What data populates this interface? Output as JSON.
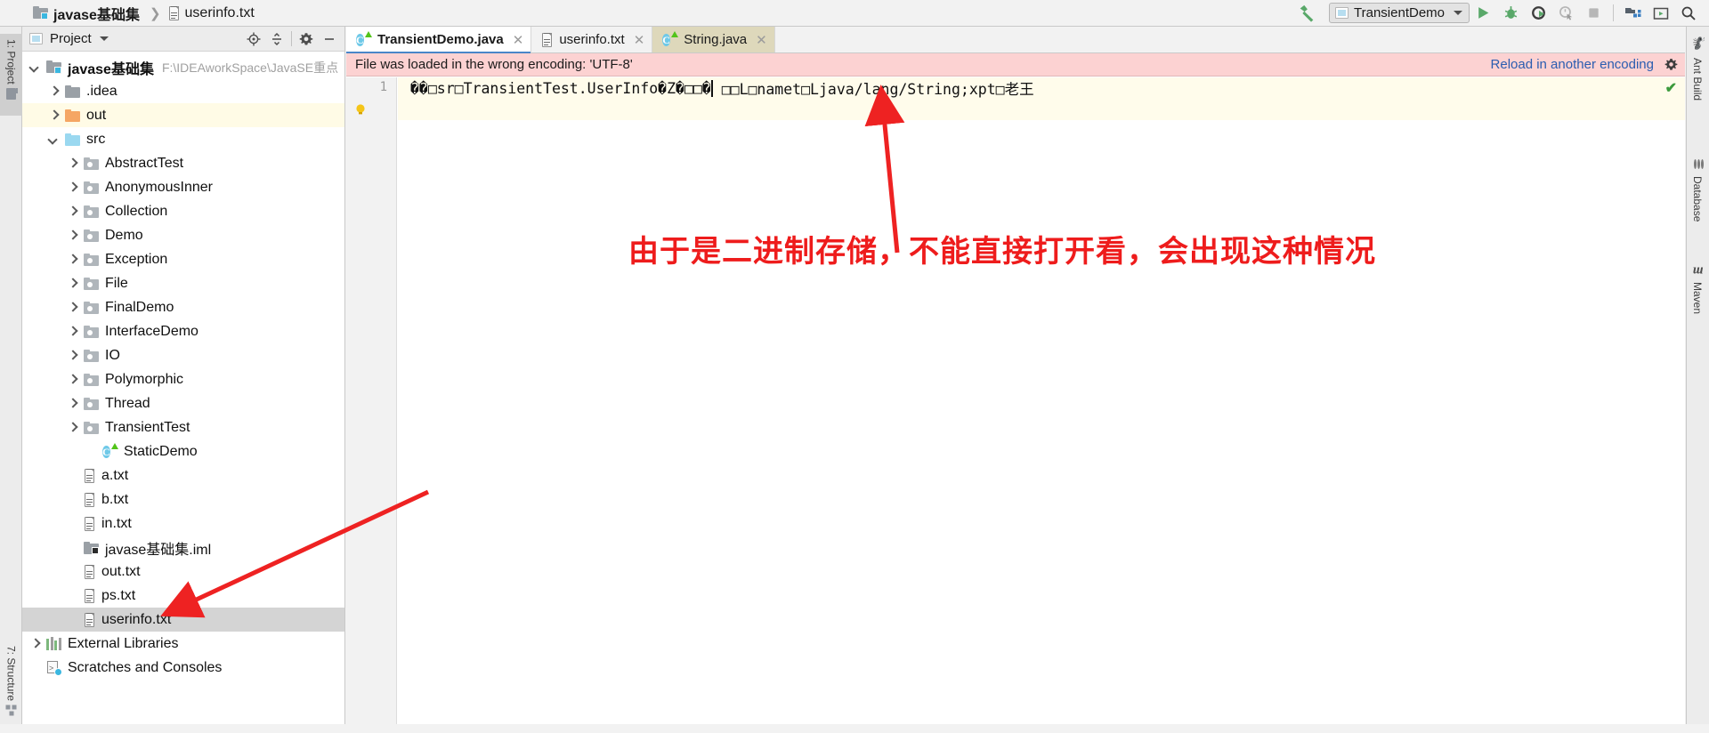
{
  "navbar": {
    "project_name": "javase基础集",
    "file_name": "userinfo.txt",
    "separator": "❯",
    "run_config": "TransientDemo",
    "icons": {
      "build": "hammer-icon",
      "run": "run-icon",
      "debug": "debug-icon",
      "run_with_coverage": "run-coverage-icon",
      "profile": "profiler-icon",
      "stop": "stop-icon",
      "project_structure": "project-structure-icon",
      "update": "update-icon",
      "search_everywhere": "search-icon"
    }
  },
  "left_strip": {
    "project_tab": "1: Project",
    "structure_tab": "7: Structure"
  },
  "right_strip": {
    "ant_build": "Ant Build",
    "database": "Database",
    "maven": "Maven"
  },
  "project_panel": {
    "title": "Project",
    "header_buttons": {
      "locate": "locate-icon",
      "collapse_all": "collapse-all-icon",
      "settings": "gear-icon",
      "hide": "minimize-icon"
    },
    "root": {
      "label": "javase基础集",
      "path": "F:\\IDEAworkSpace\\JavaSE重点"
    },
    "tree": [
      {
        "label": ".idea",
        "depth": 1,
        "arrow": "closed",
        "icon": "folder-grey",
        "state": "none"
      },
      {
        "label": "out",
        "depth": 1,
        "arrow": "closed",
        "icon": "folder-orange",
        "state": "yellow"
      },
      {
        "label": "src",
        "depth": 1,
        "arrow": "open",
        "icon": "folder-blue",
        "state": "none"
      },
      {
        "label": "AbstractTest",
        "depth": 2,
        "arrow": "closed",
        "icon": "package",
        "state": "none"
      },
      {
        "label": "AnonymousInner",
        "depth": 2,
        "arrow": "closed",
        "icon": "package",
        "state": "none"
      },
      {
        "label": "Collection",
        "depth": 2,
        "arrow": "closed",
        "icon": "package",
        "state": "none"
      },
      {
        "label": "Demo",
        "depth": 2,
        "arrow": "closed",
        "icon": "package",
        "state": "none"
      },
      {
        "label": "Exception",
        "depth": 2,
        "arrow": "closed",
        "icon": "package",
        "state": "none"
      },
      {
        "label": "File",
        "depth": 2,
        "arrow": "closed",
        "icon": "package",
        "state": "none"
      },
      {
        "label": "FinalDemo",
        "depth": 2,
        "arrow": "closed",
        "icon": "package",
        "state": "none"
      },
      {
        "label": "InterfaceDemo",
        "depth": 2,
        "arrow": "closed",
        "icon": "package",
        "state": "none"
      },
      {
        "label": "IO",
        "depth": 2,
        "arrow": "closed",
        "icon": "package",
        "state": "none"
      },
      {
        "label": "Polymorphic",
        "depth": 2,
        "arrow": "closed",
        "icon": "package",
        "state": "none"
      },
      {
        "label": "Thread",
        "depth": 2,
        "arrow": "closed",
        "icon": "package",
        "state": "none"
      },
      {
        "label": "TransientTest",
        "depth": 2,
        "arrow": "closed",
        "icon": "package",
        "state": "none"
      },
      {
        "label": "StaticDemo",
        "depth": 3,
        "arrow": "none",
        "icon": "class",
        "state": "none"
      },
      {
        "label": "a.txt",
        "depth": 2,
        "arrow": "none",
        "icon": "txt",
        "state": "none"
      },
      {
        "label": "b.txt",
        "depth": 2,
        "arrow": "none",
        "icon": "txt",
        "state": "none"
      },
      {
        "label": "in.txt",
        "depth": 2,
        "arrow": "none",
        "icon": "txt",
        "state": "none"
      },
      {
        "label": "javase基础集.iml",
        "depth": 2,
        "arrow": "none",
        "icon": "iml",
        "state": "none"
      },
      {
        "label": "out.txt",
        "depth": 2,
        "arrow": "none",
        "icon": "txt",
        "state": "none"
      },
      {
        "label": "ps.txt",
        "depth": 2,
        "arrow": "none",
        "icon": "txt",
        "state": "none"
      },
      {
        "label": "userinfo.txt",
        "depth": 2,
        "arrow": "none",
        "icon": "txt",
        "state": "grey"
      },
      {
        "label": "External Libraries",
        "depth": 0,
        "arrow": "closed",
        "icon": "libs",
        "state": "none"
      },
      {
        "label": "Scratches and Consoles",
        "depth": 0,
        "arrow": "none",
        "icon": "scratch",
        "state": "none"
      }
    ]
  },
  "editor": {
    "tabs": [
      {
        "label": "TransientDemo.java",
        "icon": "java-class-icon",
        "state": "active"
      },
      {
        "label": "userinfo.txt",
        "icon": "txt-file-icon",
        "state": "selected"
      },
      {
        "label": "String.java",
        "icon": "java-class-icon",
        "state": "highlight"
      }
    ],
    "close_glyph": "✕",
    "encoding_bar": {
      "message": "File was loaded in the wrong encoding: 'UTF-8'",
      "link": "Reload in another encoding",
      "gear": "gear-icon"
    },
    "line_number": "1",
    "content_before_caret": "��□sr□TransientTest.UserInfo�Z�□□�",
    "content_after_caret": " □□L□namet□Ljava/lang/String;xpt□老王",
    "inspection_status": "✔",
    "bulb": "intention-bulb-icon"
  },
  "annotations": {
    "note": "由于是二进制存储，不能直接打开看，会出现这种情况",
    "note_color": "#ee1c1c",
    "arrow_color": "#ee2222"
  }
}
